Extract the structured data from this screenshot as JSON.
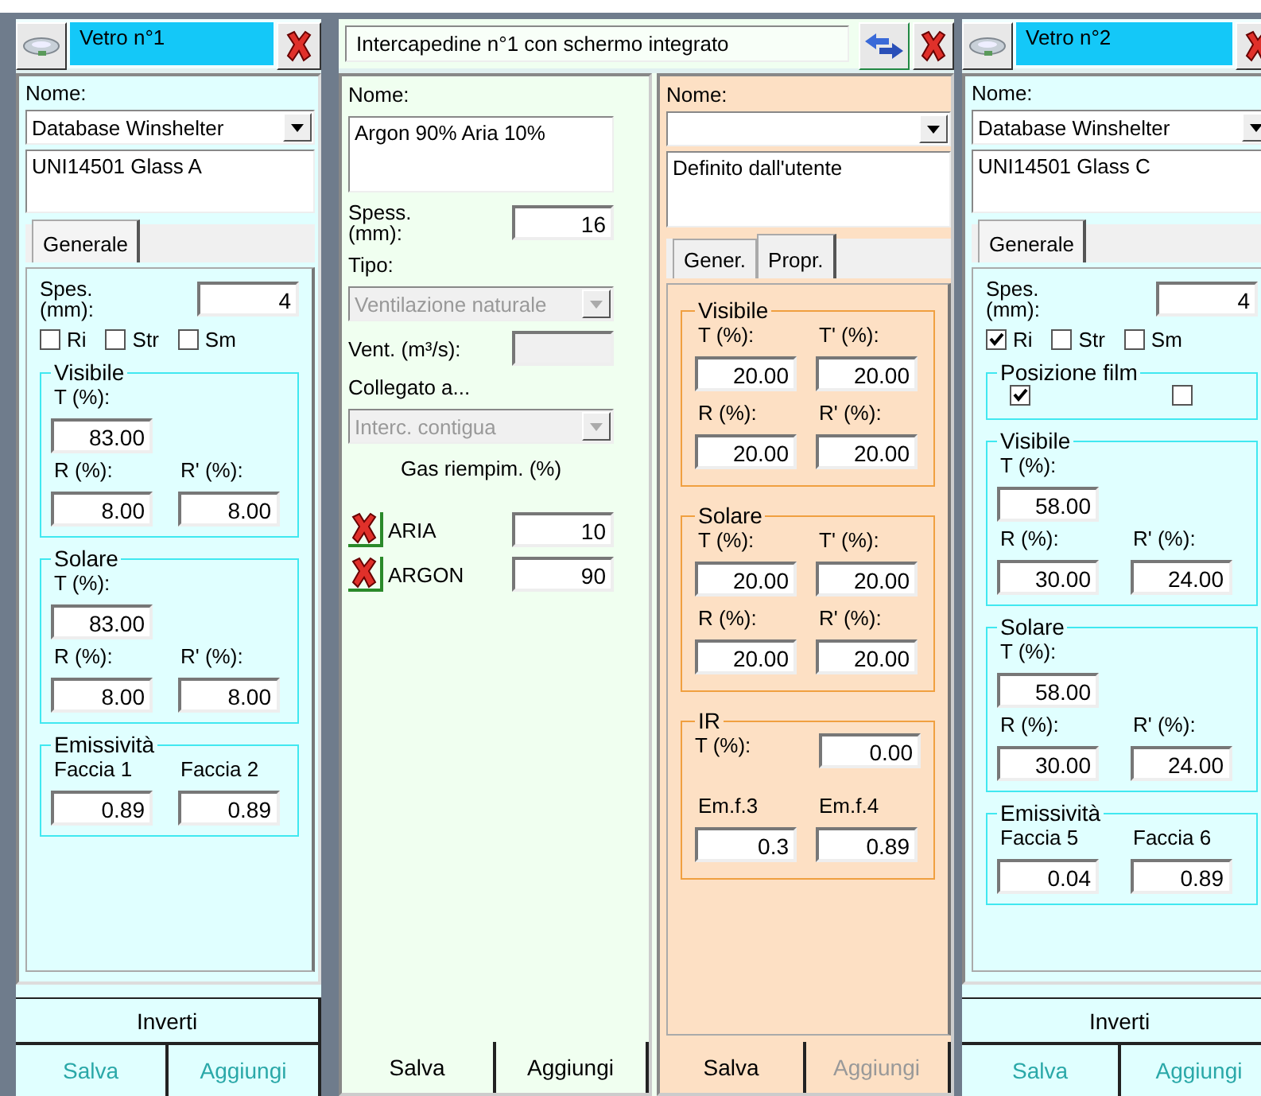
{
  "panels": [
    {
      "kind": "glass",
      "title": "Vetro n°1",
      "name_label": "Nome:",
      "source": "Database Winshelter",
      "material": "UNI14501 Glass A",
      "tabs": [
        {
          "label": "Generale",
          "selected": true
        }
      ],
      "thickness_label": "Spes. (mm):",
      "thickness": "4",
      "options": [
        {
          "label": "Ri",
          "checked": false
        },
        {
          "label": "Str",
          "checked": false
        },
        {
          "label": "Sm",
          "checked": false
        }
      ],
      "groups": [
        {
          "title": "Visibile",
          "fields": [
            {
              "kind": "wide",
              "label": "T (%):",
              "value": "83.00"
            },
            {
              "kind": "half",
              "label": "R (%):",
              "value": "8.00"
            },
            {
              "kind": "half",
              "label": "R' (%):",
              "value": "8.00"
            }
          ]
        },
        {
          "title": "Solare",
          "fields": [
            {
              "kind": "wide",
              "label": "T (%):",
              "value": "83.00"
            },
            {
              "kind": "half",
              "label": "R (%):",
              "value": "8.00"
            },
            {
              "kind": "half",
              "label": "R' (%):",
              "value": "8.00"
            }
          ]
        },
        {
          "title": "Emissività",
          "fields": [
            {
              "kind": "half",
              "label": "Faccia 1",
              "value": "0.89"
            },
            {
              "kind": "half",
              "label": "Faccia 2",
              "value": "0.89"
            }
          ]
        }
      ],
      "invert": "Inverti",
      "buttons": [
        {
          "label": "Salva",
          "disabled": false
        },
        {
          "label": "Aggiungi",
          "disabled": false
        }
      ]
    },
    {
      "kind": "gap",
      "title": "Intercapedine n°1 con schermo integrato",
      "gas": {
        "name_label": "Nome:",
        "name": "Argon 90% Aria 10%",
        "thickness_label": "Spess. (mm):",
        "thickness": "16",
        "type_label": "Tipo:",
        "type": {
          "value": "Ventilazione naturale",
          "disabled": true
        },
        "vent_label": "Vent. (m³/s):",
        "vent": {
          "disabled": true
        },
        "link_label": "Collegato a...",
        "link": {
          "value": "Interc. contigua",
          "disabled": true
        },
        "gases_title": "Gas riempim. (%)",
        "gases": [
          {
            "name": "ARIA",
            "value": "10"
          },
          {
            "name": "ARGON",
            "value": "90"
          }
        ],
        "buttons": [
          {
            "label": "Salva",
            "disabled": false
          },
          {
            "label": "Aggiungi",
            "disabled": false
          }
        ]
      },
      "screen": {
        "name_label": "Nome:",
        "material": "Definito dall'utente",
        "tabs": [
          {
            "label": "Gener.",
            "selected": false
          },
          {
            "label": "Propr.",
            "selected": true
          }
        ],
        "groups": [
          {
            "title": "Visibile",
            "fields": [
              {
                "kind": "half",
                "label": "T (%):",
                "value": "20.00"
              },
              {
                "kind": "half",
                "label": "T' (%):",
                "value": "20.00"
              },
              {
                "kind": "half",
                "label": "R (%):",
                "value": "20.00"
              },
              {
                "kind": "half",
                "label": "R' (%):",
                "value": "20.00"
              }
            ]
          },
          {
            "title": "Solare",
            "fields": [
              {
                "kind": "half",
                "label": "T (%):",
                "value": "20.00"
              },
              {
                "kind": "half",
                "label": "T' (%):",
                "value": "20.00"
              },
              {
                "kind": "half",
                "label": "R (%):",
                "value": "20.00"
              },
              {
                "kind": "half",
                "label": "R' (%):",
                "value": "20.00"
              }
            ]
          },
          {
            "title": "IR",
            "fields": [
              {
                "kind": "inline",
                "label": "T (%):",
                "value": "0.00"
              },
              {
                "kind": "half",
                "label": "Em.f.3",
                "value": "0.3"
              },
              {
                "kind": "half",
                "label": "Em.f.4",
                "value": "0.89"
              }
            ]
          }
        ],
        "buttons": [
          {
            "label": "Salva",
            "disabled": false
          },
          {
            "label": "Aggiungi",
            "disabled": true
          }
        ]
      }
    },
    {
      "kind": "glass",
      "title": "Vetro n°2",
      "name_label": "Nome:",
      "source": "Database Winshelter",
      "material": "UNI14501 Glass C",
      "tabs": [
        {
          "label": "Generale",
          "selected": true
        }
      ],
      "thickness_label": "Spes. (mm):",
      "thickness": "4",
      "options": [
        {
          "label": "Ri",
          "checked": true
        },
        {
          "label": "Str",
          "checked": false
        },
        {
          "label": "Sm",
          "checked": false
        }
      ],
      "film": {
        "title": "Posizione film",
        "positions": [
          {
            "checked": true
          },
          {
            "checked": false
          }
        ]
      },
      "groups": [
        {
          "title": "Visibile",
          "fields": [
            {
              "kind": "wide",
              "label": "T (%):",
              "value": "58.00"
            },
            {
              "kind": "half",
              "label": "R (%):",
              "value": "30.00"
            },
            {
              "kind": "half",
              "label": "R' (%):",
              "value": "24.00"
            }
          ]
        },
        {
          "title": "Solare",
          "fields": [
            {
              "kind": "wide",
              "label": "T (%):",
              "value": "58.00"
            },
            {
              "kind": "half",
              "label": "R (%):",
              "value": "30.00"
            },
            {
              "kind": "half",
              "label": "R' (%):",
              "value": "24.00"
            }
          ]
        },
        {
          "title": "Emissività",
          "fields": [
            {
              "kind": "half",
              "label": "Faccia 5",
              "value": "0.04"
            },
            {
              "kind": "half",
              "label": "Faccia 6",
              "value": "0.89"
            }
          ]
        }
      ],
      "invert": "Inverti",
      "buttons": [
        {
          "label": "Salva",
          "disabled": false
        },
        {
          "label": "Aggiungi",
          "disabled": false
        }
      ]
    }
  ]
}
